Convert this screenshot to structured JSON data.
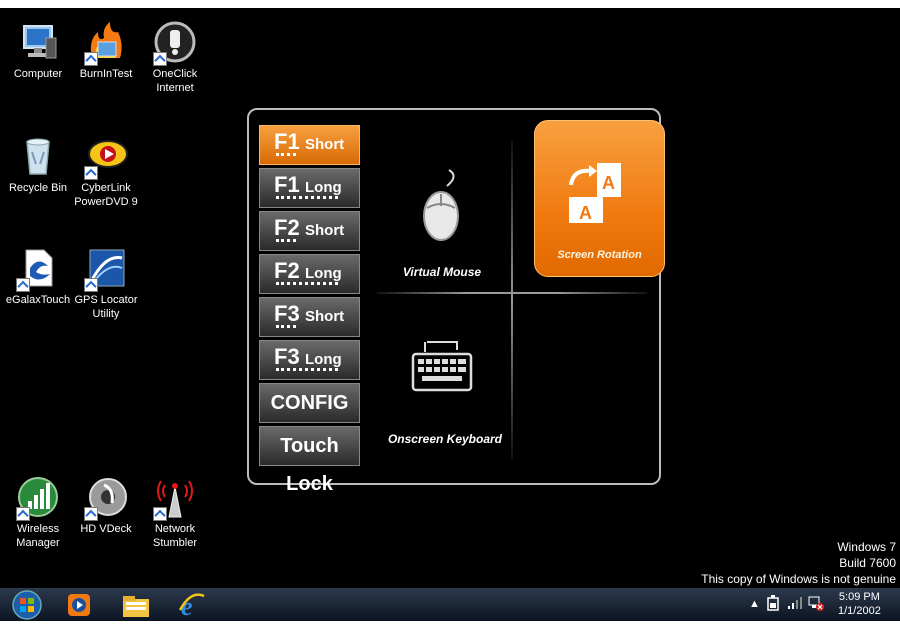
{
  "desktop_icons": [
    {
      "label": "Computer",
      "icon": "computer-icon"
    },
    {
      "label": "BurnInTest",
      "icon": "burnintest-icon"
    },
    {
      "label": "OneClick Internet",
      "icon": "oneclick-icon"
    },
    {
      "label": "Recycle Bin",
      "icon": "recycle-bin-icon"
    },
    {
      "label": "CyberLink PowerDVD 9",
      "icon": "powerdvd-icon"
    },
    {
      "label": "eGalaxTouch",
      "icon": "egalaxtouch-icon"
    },
    {
      "label": "GPS Locator Utility",
      "icon": "gps-locator-icon"
    },
    {
      "label": "Wireless Manager",
      "icon": "wireless-manager-icon"
    },
    {
      "label": "HD VDeck",
      "icon": "hd-vdeck-icon"
    },
    {
      "label": "Network Stumbler",
      "icon": "network-stumbler-icon"
    }
  ],
  "panel": {
    "buttons": [
      {
        "big": "F1",
        "small": "Short"
      },
      {
        "big": "F1",
        "small": "Long"
      },
      {
        "big": "F2",
        "small": "Short"
      },
      {
        "big": "F2",
        "small": "Long"
      },
      {
        "big": "F3",
        "small": "Short"
      },
      {
        "big": "F3",
        "small": "Long"
      }
    ],
    "config_label": "CONFIG",
    "touch_lock_label": "Touch Lock",
    "virtual_mouse_label": "Virtual Mouse",
    "onscreen_keyboard_label": "Onscreen Keyboard",
    "screen_rotation_label": "Screen Rotation"
  },
  "watermark": {
    "line1": "Windows 7",
    "line2": "Build 7600",
    "line3": "This copy of Windows is not genuine"
  },
  "taskbar": {
    "time": "5:09 PM",
    "date": "1/1/2002",
    "pinned": [
      "start-orb-icon",
      "media-player-icon",
      "explorer-icon",
      "internet-explorer-icon"
    ]
  },
  "colors": {
    "accent": "#f07a10",
    "desktop": "#000000"
  }
}
